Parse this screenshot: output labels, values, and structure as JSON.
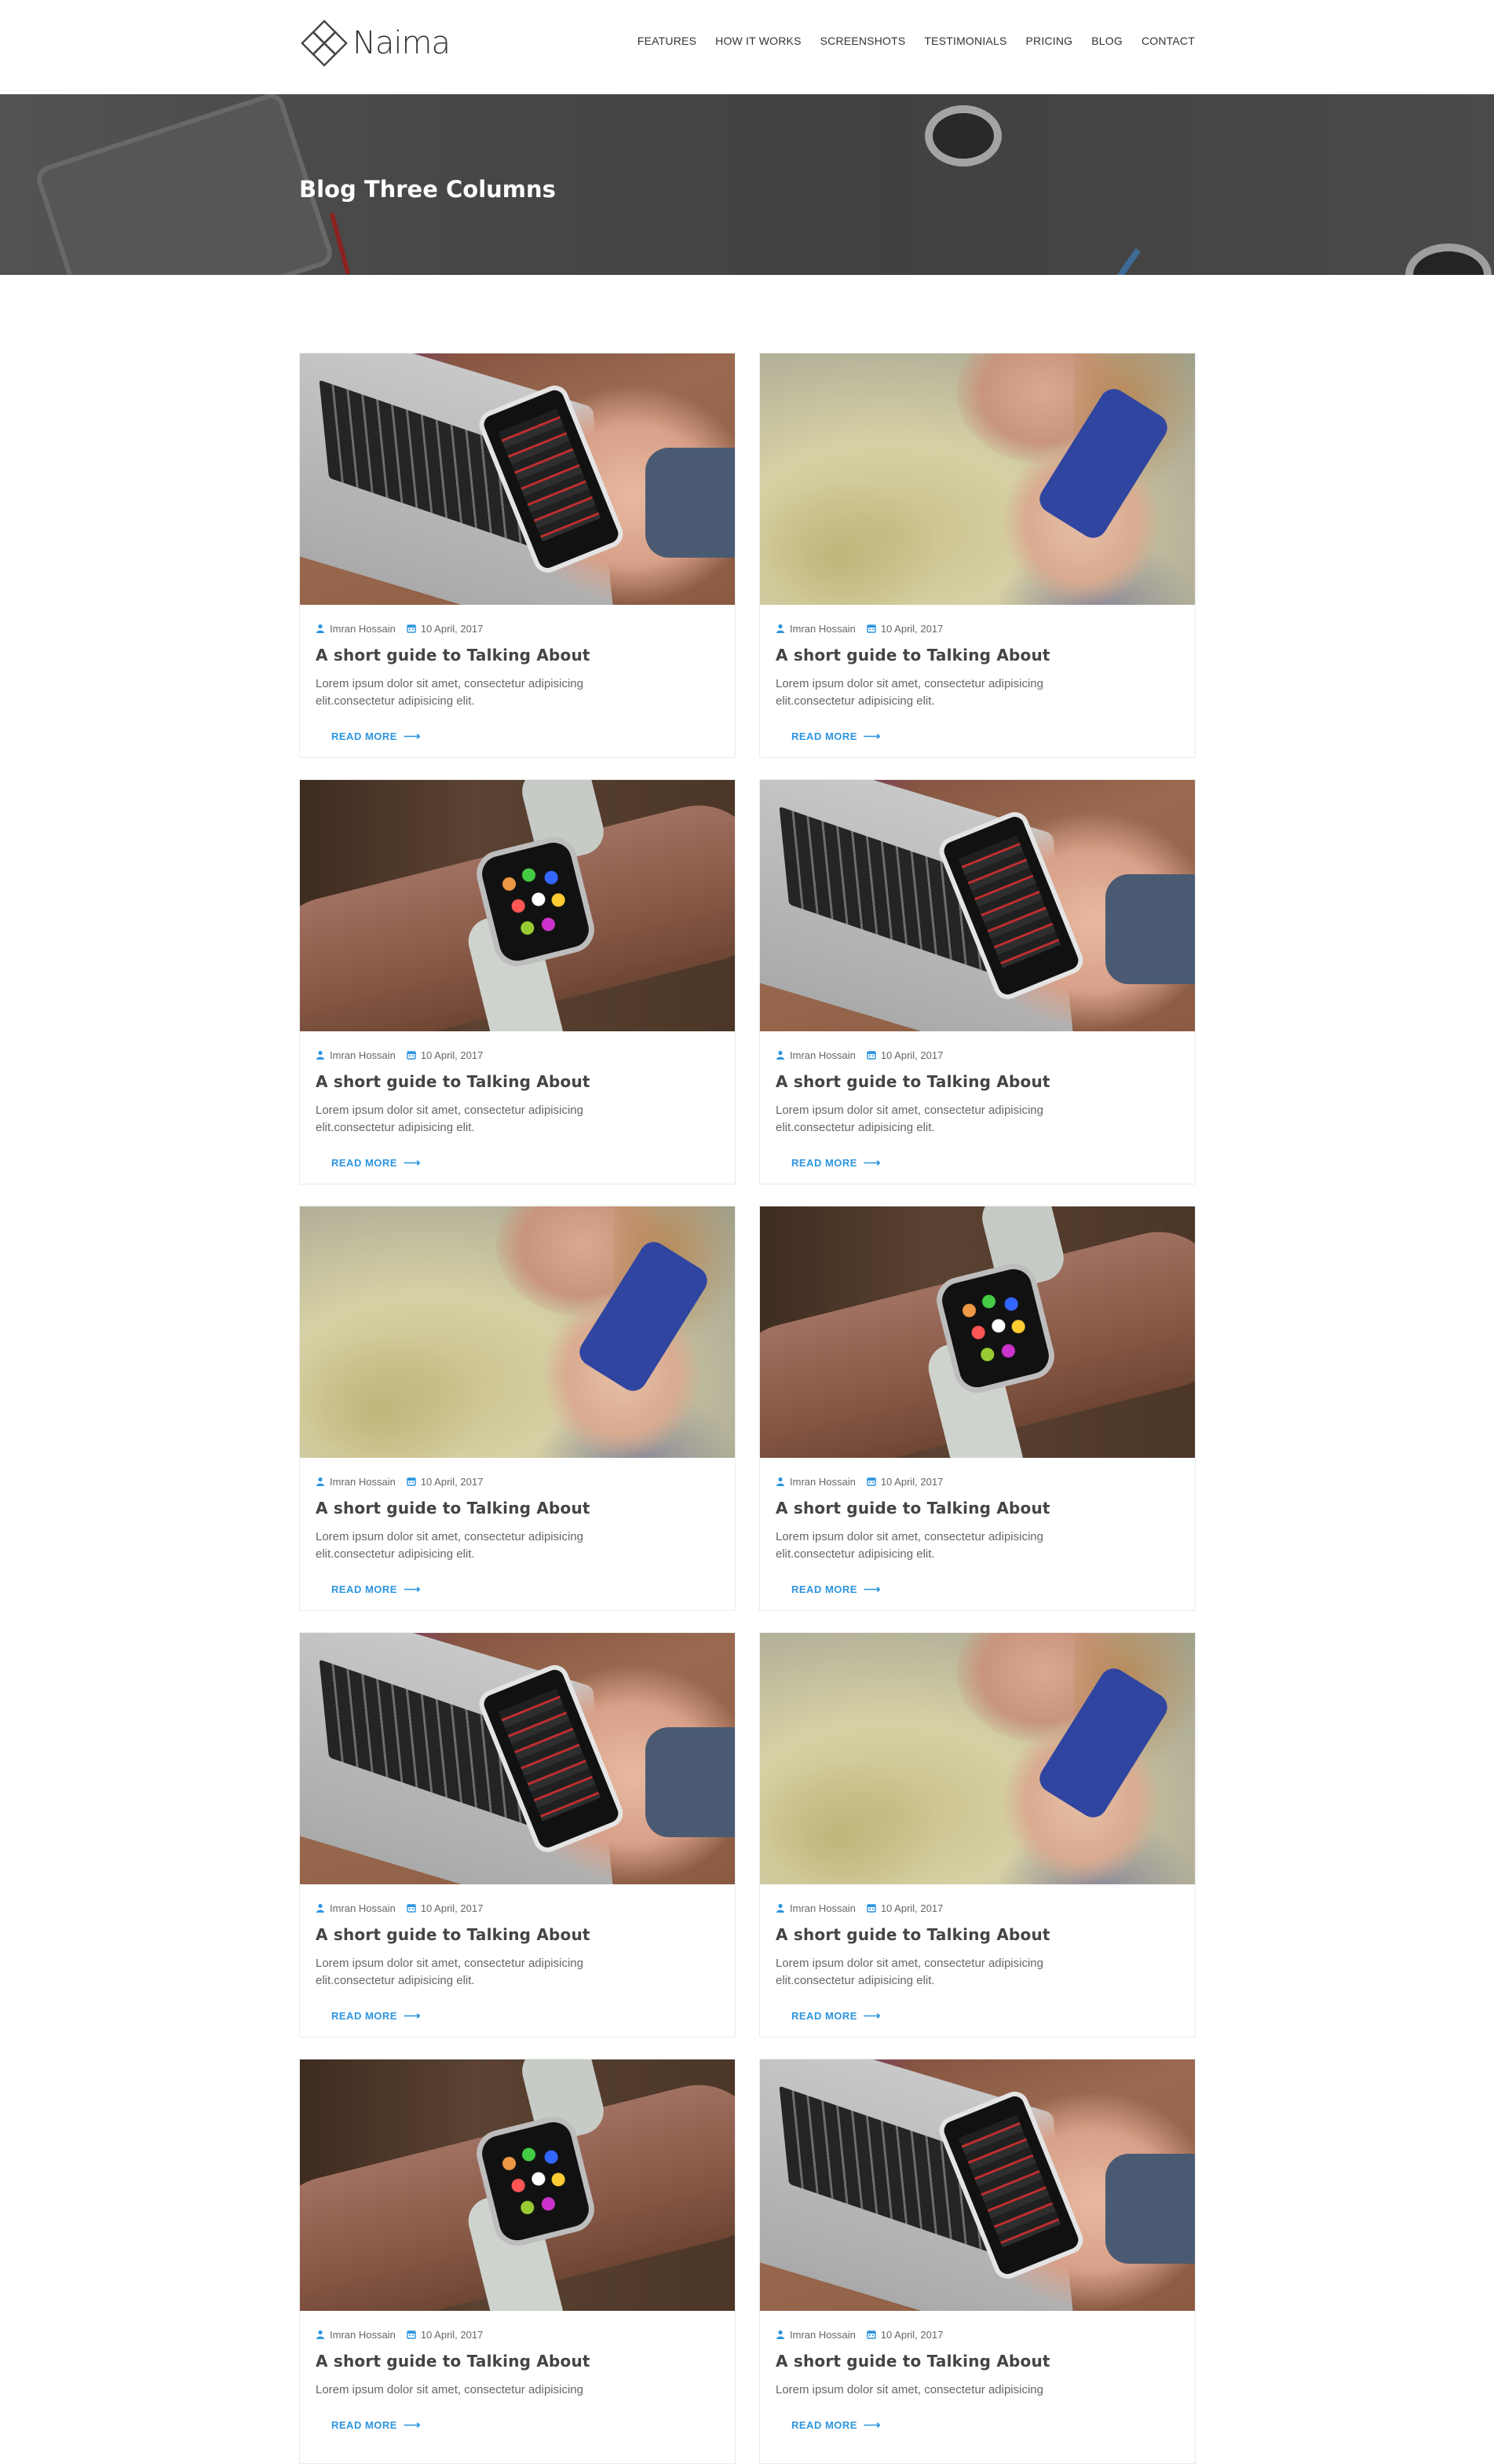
{
  "header": {
    "logo_text": "Naima",
    "nav": [
      "FEATURES",
      "HOW IT WORKS",
      "SCREENSHOTS",
      "TESTIMONIALS",
      "PRICING",
      "BLOG",
      "CONTACT"
    ]
  },
  "banner": {
    "title": "Blog Three Columns"
  },
  "posts": [
    {
      "image": "laptop-phone",
      "author": "Imran Hossain",
      "date": "10 April, 2017",
      "title": "A short guide to Talking About",
      "excerpt": "Lorem ipsum dolor sit amet, consectetur adipisicing elit.consectetur adipisicing elit.",
      "read_more": "READ MORE"
    },
    {
      "image": "girl-phone",
      "author": "Imran Hossain",
      "date": "10 April, 2017",
      "title": "A short guide to Talking About",
      "excerpt": "Lorem ipsum dolor sit amet, consectetur adipisicing elit.consectetur adipisicing elit.",
      "read_more": "READ MORE"
    },
    {
      "image": "smartwatch",
      "author": "Imran Hossain",
      "date": "10 April, 2017",
      "title": "A short guide to Talking About",
      "excerpt": "Lorem ipsum dolor sit amet, consectetur adipisicing elit.consectetur adipisicing elit.",
      "read_more": "READ MORE"
    },
    {
      "image": "laptop-phone",
      "author": "Imran Hossain",
      "date": "10 April, 2017",
      "title": "A short guide to Talking About",
      "excerpt": "Lorem ipsum dolor sit amet, consectetur adipisicing elit.consectetur adipisicing elit.",
      "read_more": "READ MORE"
    },
    {
      "image": "girl-phone",
      "author": "Imran Hossain",
      "date": "10 April, 2017",
      "title": "A short guide to Talking About",
      "excerpt": "Lorem ipsum dolor sit amet, consectetur adipisicing elit.consectetur adipisicing elit.",
      "read_more": "READ MORE"
    },
    {
      "image": "smartwatch",
      "author": "Imran Hossain",
      "date": "10 April, 2017",
      "title": "A short guide to Talking About",
      "excerpt": "Lorem ipsum dolor sit amet, consectetur adipisicing elit.consectetur adipisicing elit.",
      "read_more": "READ MORE"
    },
    {
      "image": "laptop-phone",
      "author": "Imran Hossain",
      "date": "10 April, 2017",
      "title": "A short guide to Talking About",
      "excerpt": "Lorem ipsum dolor sit amet, consectetur adipisicing elit.consectetur adipisicing elit.",
      "read_more": "READ MORE"
    },
    {
      "image": "girl-phone",
      "author": "Imran Hossain",
      "date": "10 April, 2017",
      "title": "A short guide to Talking About",
      "excerpt": "Lorem ipsum dolor sit amet, consectetur adipisicing elit.consectetur adipisicing elit.",
      "read_more": "READ MORE"
    },
    {
      "image": "smartwatch",
      "author": "Imran Hossain",
      "date": "10 April, 2017",
      "title": "A short guide to Talking About",
      "excerpt": "Lorem ipsum dolor sit amet, consectetur adipisicing",
      "read_more": "READ MORE"
    },
    {
      "image": "laptop-phone",
      "author": "Imran Hossain",
      "date": "10 April, 2017",
      "title": "A short guide to Talking About",
      "excerpt": "Lorem ipsum dolor sit amet, consectetur adipisicing",
      "read_more": "READ MORE"
    }
  ],
  "colors": {
    "accent": "#2d95e0",
    "text_dark": "#444444",
    "banner_overlay": "#4f4f4f"
  },
  "icons": {
    "author": "user-icon",
    "date": "calendar-icon",
    "read_more": "arrow-right-icon"
  }
}
